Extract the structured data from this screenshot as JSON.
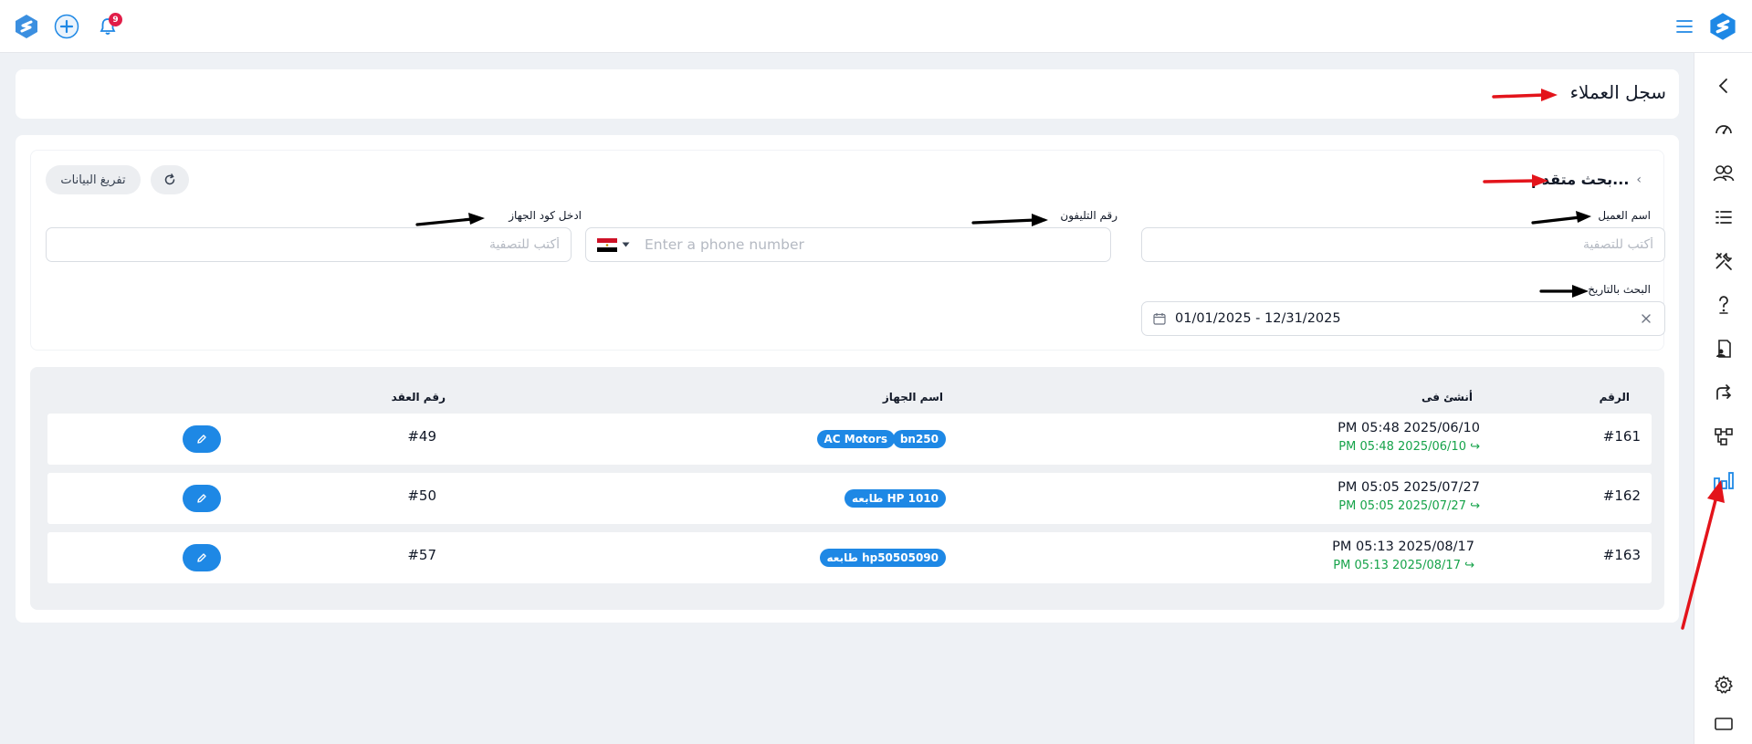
{
  "topbar": {
    "notification_count": "9",
    "icons": [
      "logo-icon",
      "plus-icon",
      "bell-icon",
      "menu-icon",
      "logo-icon"
    ]
  },
  "sidebar": {
    "items": [
      "chevron-left-icon",
      "speedometer-icon",
      "users-icon",
      "list-icon",
      "tools-icon",
      "help-icon",
      "document-user-icon",
      "transfer-icon",
      "hierarchy-icon",
      "chart-bar-icon",
      "settings-icon",
      "window-icon"
    ],
    "active": "chart-bar-icon"
  },
  "page": {
    "title": "سجل العملاء"
  },
  "search": {
    "title": "بحث متقدم...",
    "clear_label": "تفريغ البيانات",
    "customer_name": {
      "label": "اسم العميل",
      "placeholder": "أكتب للتصفية"
    },
    "phone": {
      "label": "رقم التليفون",
      "placeholder": "Enter a phone number"
    },
    "device_code": {
      "label": "ادخل كود الجهاز",
      "placeholder": "أكتب للتصفية"
    },
    "date": {
      "label": "البحث بالتاريخ",
      "value": "01/01/2025 - 12/31/2025"
    }
  },
  "table": {
    "headers": {
      "number": "الرقم",
      "created_at": "أنشئ فى",
      "device_name": "اسم الجهاز",
      "contract_number": "رقم العقد"
    },
    "rows": [
      {
        "number": "#161",
        "created": "PM 05:48 2025/06/10",
        "created_sub": "PM 05:48 2025/06/10 ↪",
        "tags": [
          "bn250",
          "AC Motors"
        ],
        "contract": "#49"
      },
      {
        "number": "#162",
        "created": "PM 05:05 2025/07/27",
        "created_sub": "PM 05:05 2025/07/27 ↪",
        "tags": [
          "طابعه HP 1010"
        ],
        "contract": "#50"
      },
      {
        "number": "#163",
        "created": "PM 05:13 2025/08/17",
        "created_sub": "PM 05:13 2025/08/17 ↪",
        "tags": [
          "طابعه hp50505090"
        ],
        "contract": "#57"
      }
    ]
  },
  "colors": {
    "accent": "#1e88e5",
    "success": "#16a34a",
    "badge": "#e11d48",
    "annotation_red": "#e3141b",
    "annotation_black": "#000000"
  }
}
